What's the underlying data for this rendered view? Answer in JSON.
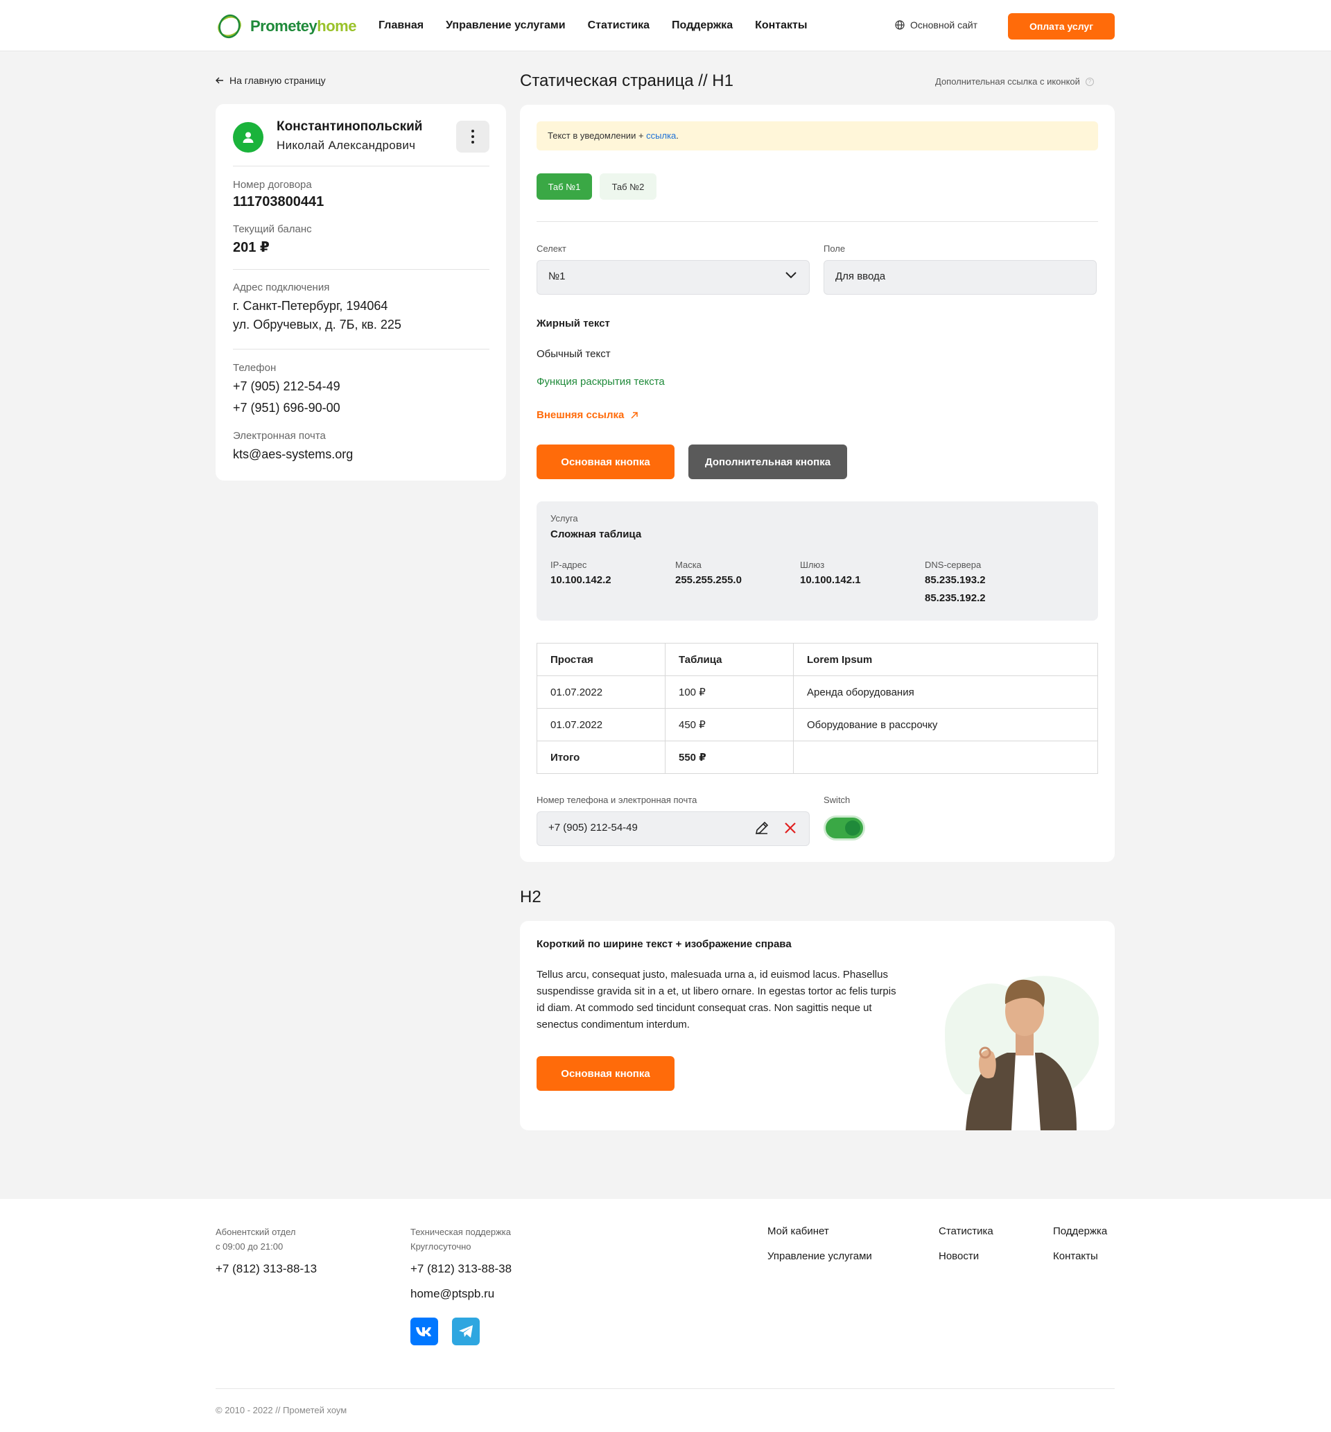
{
  "header": {
    "logo_part1": "Prometey",
    "logo_part2": "home",
    "nav": [
      "Главная",
      "Управление услугами",
      "Статистика",
      "Поддержка",
      "Контакты"
    ],
    "main_site": "Основной сайт",
    "pay_button": "Оплата услуг",
    "brand_green": "#1f8a3a",
    "brand_orange": "#ff6b0a"
  },
  "sidebar": {
    "back_link": "На главную страницу",
    "profile": {
      "last_name": "Константинопольский",
      "first_name": "Николай  Александрович"
    },
    "contract_label": "Номер договора",
    "contract_value": "111703800441",
    "balance_label": "Текущий баланс",
    "balance_value": "201 ₽",
    "address_label": "Адрес подключения",
    "address_line1": "г. Санкт-Петербург, 194064",
    "address_line2": "ул. Обручевых, д. 7Б, кв. 225",
    "phone_label": "Телефон",
    "phone1": "+7 (905) 212-54-49",
    "phone2": "+7 (951) 696-90-00",
    "email_label": "Электронная почта",
    "email_value": "kts@aes-systems.org"
  },
  "main": {
    "h1": "Статическая страница // H1",
    "extra_link": "Дополнительная ссылка с иконкой",
    "notice_text": "Текст в уведомлении + ",
    "notice_link": "ссылка",
    "notice_dot": ".",
    "tabs": [
      "Таб №1",
      "Таб №2"
    ],
    "select_label": "Селект",
    "select_value": "№1",
    "field_label": "Поле",
    "field_value": "Для ввода",
    "bold_text": "Жирный текст",
    "normal_text": "Обычный текст",
    "expand_text": "Функция раскрытия текста",
    "external_link": "Внешняя ссылка",
    "primary_button": "Основная кнопка",
    "secondary_button": "Дополнительная кнопка",
    "service": {
      "label": "Услуга",
      "name": "Сложная таблица",
      "ip_label": "IP-адрес",
      "ip_value": "10.100.142.2",
      "mask_label": "Маска",
      "mask_value": "255.255.255.0",
      "gateway_label": "Шлюз",
      "gateway_value": "10.100.142.1",
      "dns_label": "DNS-сервера",
      "dns_value1": "85.235.193.2",
      "dns_value2": "85.235.192.2"
    },
    "table": {
      "headers": [
        "Простая",
        "Таблица",
        "Lorem Ipsum"
      ],
      "rows": [
        [
          "01.07.2022",
          "100 ₽",
          "Аренда оборудования"
        ],
        [
          "01.07.2022",
          "450 ₽",
          "Оборудование в рассрочку"
        ]
      ],
      "total": [
        "Итого",
        "550 ₽",
        ""
      ]
    },
    "contact_label": "Номер телефона и электронная почта",
    "contact_value": "+7 (905) 212-54-49",
    "switch_label": "Switch",
    "switch_on": true
  },
  "section2": {
    "h2": "H2",
    "title": "Короткий по ширине текст + изображение справа",
    "body": "Tellus arcu, consequat justo, malesuada urna a, id euismod lacus. Phasellus suspendisse gravida sit in a et, ut libero ornare. In egestas tortor ac felis turpis id diam. At commodo sed tincidunt consequat cras. Non sagittis neque ut senectus condimentum interdum.",
    "button": "Основная кнопка"
  },
  "footer": {
    "dept_title": "Абонентский отдел",
    "dept_hours": "с 09:00 до 21:00",
    "dept_phone": "+7 (812) 313-88-13",
    "support_title": "Техническая поддержка",
    "support_hours": "Круглосуточно",
    "support_phone": "+7 (812) 313-88-38",
    "support_email": "home@ptspb.ru",
    "links": {
      "cabinet": "Мой кабинет",
      "services": "Управление услугами",
      "stats": "Статистика",
      "news": "Новости",
      "support": "Поддержка",
      "contacts": "Контакты"
    },
    "copyright": "© 2010 - 2022 // Прометей хоум"
  }
}
